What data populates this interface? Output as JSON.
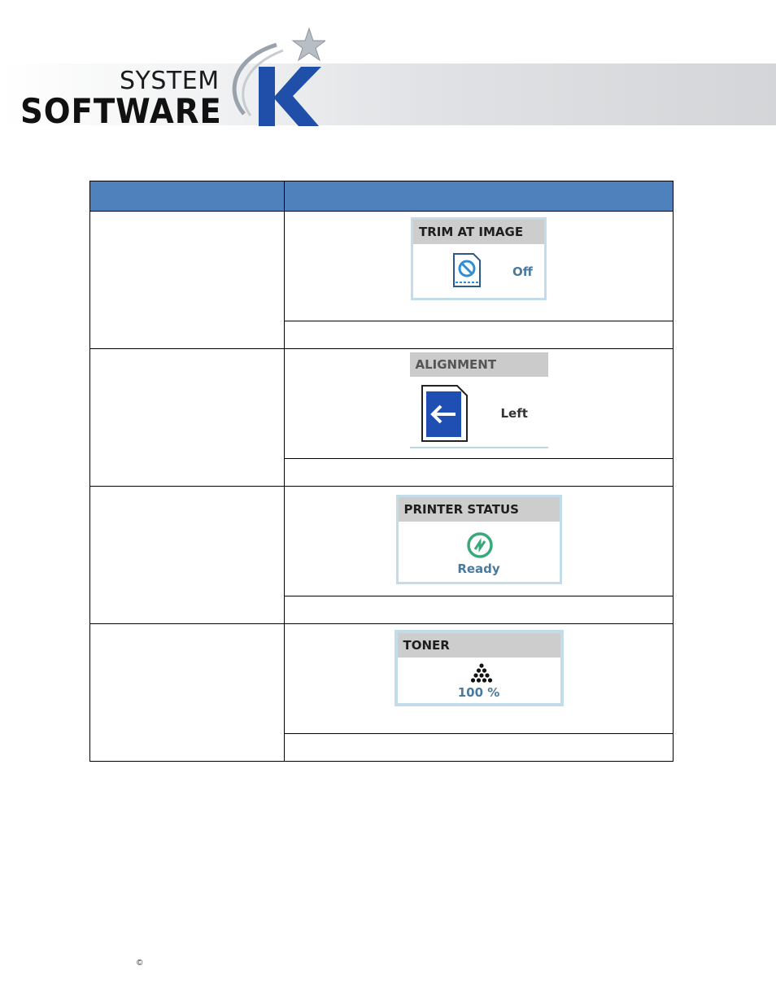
{
  "header": {
    "brand_line1": "SYSTEM",
    "brand_line2": "SOFTWARE",
    "brand_letter": "K"
  },
  "table": {
    "rows": [
      {
        "widget_title": "TRIM AT IMAGE",
        "widget_value": "Off",
        "icon": "trim-off-icon"
      },
      {
        "widget_title": "ALIGNMENT",
        "widget_value": "Left",
        "icon": "align-left-arrow-icon"
      },
      {
        "widget_title": "PRINTER STATUS",
        "widget_value": "Ready",
        "icon": "printer-ready-icon"
      },
      {
        "widget_title": "TONER",
        "widget_value": "100 %",
        "icon": "toner-pyramid-icon"
      }
    ]
  },
  "footer": {
    "copyright_symbol": "©"
  },
  "colors": {
    "header_blue": "#4f81bd",
    "value_blue": "#4a7a9c",
    "ready_green": "#3aa97a",
    "align_blue": "#1f4fb3"
  }
}
